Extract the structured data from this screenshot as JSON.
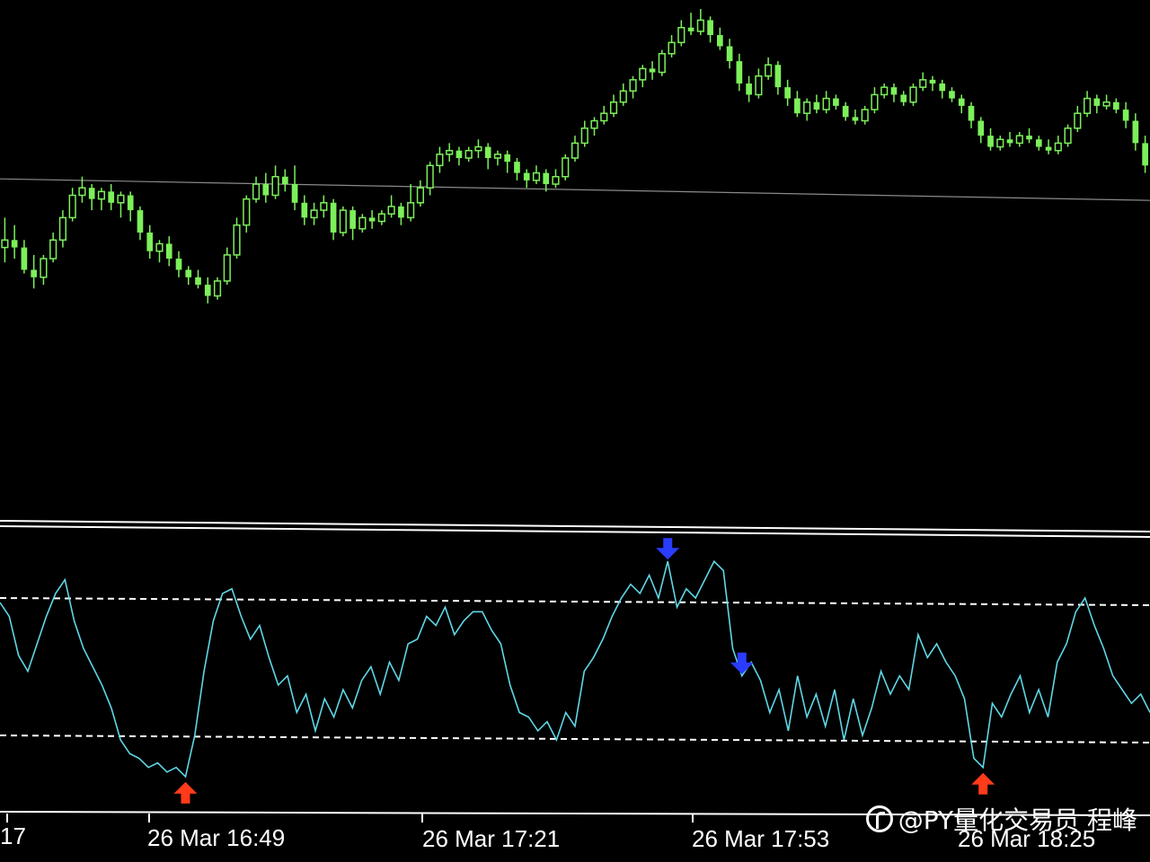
{
  "colors": {
    "background": "#000000",
    "candle": "#7cf05a",
    "oscillator": "#5fd7e6",
    "level_line": "#ffffff",
    "price_line": "#8a8a8a",
    "buy_arrow": "#ff3b1a",
    "sell_arrow": "#2a3cff"
  },
  "x_axis": {
    "tick_labels": [
      "17",
      "26 Mar 16:49",
      "26 Mar 17:21",
      "26 Mar 17:53",
      "26 Mar 18:25"
    ]
  },
  "watermark": {
    "text": "@PY量化交易员 程峰",
    "icon": "weibo-logo-icon"
  },
  "chart_data": [
    {
      "type": "candlestick",
      "y_range": [
        0,
        100
      ],
      "horizontal_line": 52,
      "candles": [
        [
          36,
          38,
          44,
          32
        ],
        [
          38,
          36,
          42,
          33
        ],
        [
          36,
          30,
          38,
          29
        ],
        [
          30,
          28,
          34,
          25
        ],
        [
          28,
          33,
          34,
          26
        ],
        [
          33,
          38,
          40,
          32
        ],
        [
          38,
          44,
          46,
          36
        ],
        [
          44,
          50,
          52,
          43
        ],
        [
          50,
          52,
          55,
          48
        ],
        [
          52,
          49,
          53,
          46
        ],
        [
          49,
          51,
          52,
          46
        ],
        [
          51,
          48,
          53,
          46
        ],
        [
          48,
          50,
          51,
          44
        ],
        [
          50,
          46,
          51,
          43
        ],
        [
          46,
          40,
          47,
          38
        ],
        [
          40,
          35,
          42,
          33
        ],
        [
          35,
          37,
          38,
          32
        ],
        [
          37,
          33,
          39,
          31
        ],
        [
          33,
          30,
          35,
          28
        ],
        [
          30,
          28,
          31,
          26
        ],
        [
          28,
          26,
          30,
          25
        ],
        [
          26,
          23,
          28,
          21
        ],
        [
          23,
          27,
          28,
          22
        ],
        [
          27,
          34,
          36,
          26
        ],
        [
          34,
          42,
          44,
          33
        ],
        [
          42,
          49,
          50,
          40
        ],
        [
          49,
          53,
          55,
          48
        ],
        [
          53,
          50,
          56,
          48
        ],
        [
          50,
          55,
          58,
          49
        ],
        [
          55,
          53,
          57,
          51
        ],
        [
          53,
          48,
          58,
          46
        ],
        [
          48,
          44,
          50,
          42
        ],
        [
          44,
          46,
          48,
          42
        ],
        [
          46,
          48,
          50,
          44
        ],
        [
          48,
          40,
          49,
          38
        ],
        [
          40,
          46,
          47,
          39
        ],
        [
          46,
          41,
          47,
          38
        ],
        [
          41,
          44,
          45,
          40
        ],
        [
          44,
          43,
          46,
          41
        ],
        [
          43,
          45,
          46,
          42
        ],
        [
          45,
          47,
          50,
          44
        ],
        [
          47,
          44,
          48,
          42
        ],
        [
          44,
          48,
          53,
          43
        ],
        [
          48,
          52,
          54,
          47
        ],
        [
          52,
          58,
          59,
          50
        ],
        [
          58,
          61,
          63,
          56
        ],
        [
          61,
          62,
          64,
          59
        ],
        [
          62,
          60,
          63,
          58
        ],
        [
          60,
          62,
          63,
          59
        ],
        [
          62,
          63,
          65,
          60
        ],
        [
          63,
          60,
          64,
          57
        ],
        [
          60,
          61,
          62,
          58
        ],
        [
          61,
          59,
          62,
          56
        ],
        [
          59,
          56,
          60,
          54
        ],
        [
          56,
          54,
          57,
          52
        ],
        [
          54,
          56,
          58,
          53
        ],
        [
          56,
          53,
          57,
          51
        ],
        [
          53,
          55,
          57,
          52
        ],
        [
          55,
          60,
          61,
          54
        ],
        [
          60,
          64,
          66,
          59
        ],
        [
          64,
          68,
          70,
          63
        ],
        [
          68,
          70,
          71,
          66
        ],
        [
          70,
          72,
          74,
          69
        ],
        [
          72,
          75,
          77,
          71
        ],
        [
          75,
          78,
          80,
          74
        ],
        [
          78,
          81,
          82,
          76
        ],
        [
          81,
          84,
          85,
          79
        ],
        [
          84,
          83,
          86,
          81
        ],
        [
          83,
          88,
          89,
          82
        ],
        [
          88,
          91,
          93,
          87
        ],
        [
          91,
          95,
          97,
          90
        ],
        [
          95,
          94,
          99,
          93
        ],
        [
          94,
          97,
          100,
          93
        ],
        [
          97,
          93,
          98,
          91
        ],
        [
          93,
          90,
          95,
          89
        ],
        [
          90,
          86,
          92,
          84
        ],
        [
          86,
          80,
          88,
          78
        ],
        [
          80,
          77,
          82,
          75
        ],
        [
          77,
          82,
          84,
          76
        ],
        [
          82,
          85,
          87,
          81
        ],
        [
          85,
          79,
          86,
          77
        ],
        [
          79,
          76,
          81,
          74
        ],
        [
          76,
          72,
          78,
          71
        ],
        [
          72,
          75,
          76,
          70
        ],
        [
          75,
          73,
          77,
          72
        ],
        [
          73,
          76,
          78,
          72
        ],
        [
          76,
          74,
          77,
          73
        ],
        [
          74,
          71,
          75,
          70
        ],
        [
          71,
          70,
          73,
          69
        ],
        [
          70,
          73,
          74,
          69
        ],
        [
          73,
          77,
          79,
          72
        ],
        [
          77,
          79,
          80,
          76
        ],
        [
          79,
          77,
          80,
          75
        ],
        [
          77,
          75,
          78,
          74
        ],
        [
          75,
          79,
          80,
          74
        ],
        [
          79,
          81,
          83,
          78
        ],
        [
          81,
          80,
          82,
          78
        ],
        [
          80,
          78,
          81,
          76
        ],
        [
          78,
          76,
          79,
          75
        ],
        [
          76,
          74,
          77,
          72
        ],
        [
          74,
          70,
          75,
          68
        ],
        [
          70,
          66,
          71,
          64
        ],
        [
          66,
          63,
          68,
          62
        ],
        [
          63,
          65,
          66,
          62
        ],
        [
          65,
          64,
          67,
          63
        ],
        [
          64,
          66,
          67,
          63
        ],
        [
          66,
          65,
          68,
          64
        ],
        [
          65,
          63,
          66,
          62
        ],
        [
          63,
          62,
          65,
          61
        ],
        [
          62,
          64,
          66,
          61
        ],
        [
          64,
          68,
          69,
          63
        ],
        [
          68,
          72,
          74,
          67
        ],
        [
          72,
          76,
          78,
          71
        ],
        [
          76,
          74,
          77,
          72
        ],
        [
          74,
          75,
          77,
          73
        ],
        [
          75,
          73,
          76,
          72
        ],
        [
          73,
          70,
          75,
          68
        ],
        [
          70,
          64,
          72,
          62
        ],
        [
          64,
          58,
          66,
          56
        ]
      ]
    },
    {
      "type": "line",
      "y_range": [
        0,
        100
      ],
      "levels": [
        80,
        20
      ],
      "values": [
        78,
        72,
        55,
        48,
        60,
        72,
        82,
        88,
        70,
        58,
        50,
        42,
        32,
        18,
        12,
        10,
        6,
        8,
        4,
        6,
        2,
        20,
        48,
        70,
        82,
        84,
        72,
        62,
        68,
        54,
        42,
        46,
        30,
        38,
        22,
        36,
        28,
        40,
        32,
        44,
        50,
        38,
        52,
        44,
        60,
        62,
        72,
        68,
        76,
        64,
        70,
        74,
        74,
        66,
        60,
        42,
        30,
        28,
        22,
        26,
        18,
        30,
        24,
        48,
        54,
        62,
        72,
        80,
        86,
        82,
        90,
        80,
        96,
        76,
        84,
        80,
        88,
        96,
        92,
        58,
        46,
        52,
        44,
        30,
        40,
        22,
        46,
        28,
        38,
        24,
        40,
        18,
        36,
        20,
        32,
        48,
        38,
        46,
        40,
        64,
        54,
        60,
        52,
        46,
        36,
        10,
        6,
        34,
        28,
        38,
        46,
        30,
        40,
        28,
        52,
        60,
        74,
        80,
        68,
        58,
        46,
        40,
        34,
        38,
        30
      ],
      "markers": [
        {
          "type": "buy",
          "index": 20
        },
        {
          "type": "sell",
          "index": 72
        },
        {
          "type": "sell",
          "index": 80
        },
        {
          "type": "buy",
          "index": 106
        }
      ]
    }
  ]
}
